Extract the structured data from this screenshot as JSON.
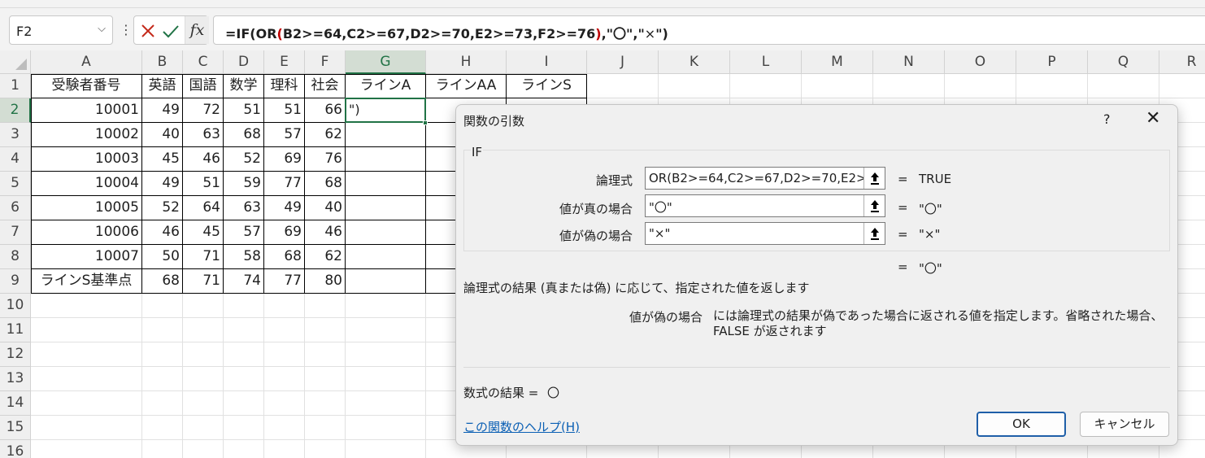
{
  "namebox": {
    "value": "F2"
  },
  "formula_bar": {
    "fx_label": "fx",
    "parts": [
      "=IF",
      "(",
      "OR",
      "(",
      "B2>=64,C2>=67,D2>=70,E2>=73,F2>=76",
      ")",
      ",\"〇\",\"",
      "×",
      "\")"
    ]
  },
  "sheet": {
    "columns": [
      "A",
      "B",
      "C",
      "D",
      "E",
      "F",
      "G",
      "H",
      "I",
      "J",
      "K",
      "L",
      "M",
      "N",
      "O",
      "P",
      "Q",
      "R"
    ],
    "rows": [
      "1",
      "2",
      "3",
      "4",
      "5",
      "6",
      "7",
      "8",
      "9",
      "10",
      "11",
      "12",
      "13",
      "14",
      "15",
      "16"
    ],
    "header_row": [
      "受験者番号",
      "英語",
      "国語",
      "数学",
      "理科",
      "社会",
      "ラインA",
      "ラインAA",
      "ラインS"
    ],
    "data_rows": [
      [
        "10001",
        "49",
        "72",
        "51",
        "51",
        "66"
      ],
      [
        "10002",
        "40",
        "63",
        "68",
        "57",
        "62"
      ],
      [
        "10003",
        "45",
        "46",
        "52",
        "69",
        "76"
      ],
      [
        "10004",
        "49",
        "51",
        "59",
        "77",
        "68"
      ],
      [
        "10005",
        "52",
        "64",
        "63",
        "49",
        "40"
      ],
      [
        "10006",
        "46",
        "45",
        "57",
        "69",
        "46"
      ],
      [
        "10007",
        "50",
        "71",
        "58",
        "68",
        "62"
      ],
      [
        "ラインS基準点",
        "68",
        "71",
        "74",
        "77",
        "80"
      ]
    ],
    "active_cell_text": "\")"
  },
  "dialog": {
    "title": "関数の引数",
    "help_glyph": "?",
    "close_glyph": "✕",
    "function_name": "IF",
    "args": [
      {
        "label": "論理式",
        "value": "OR(B2>=64,C2>=67,D2>=70,E2>",
        "eq": "=",
        "result": "TRUE"
      },
      {
        "label": "値が真の場合",
        "value": "\"〇\"",
        "eq": "=",
        "result": "\"〇\""
      },
      {
        "label": "値が偽の場合",
        "value": "\"×\"",
        "eq": "=",
        "result": "\"×\""
      }
    ],
    "overall_eq": "=",
    "overall_result": "\"〇\"",
    "description": "論理式の結果 (真または偽) に応じて、指定された値を返します",
    "arg_desc_name": "値が偽の場合",
    "arg_desc_text": "には論理式の結果が偽であった場合に返される値を指定します。省略された場合、FALSE が返されます",
    "formula_result_label": "数式の結果 =",
    "formula_result_value": "〇",
    "help_link": "この関数のヘルプ(H)",
    "ok_label": "OK",
    "cancel_label": "キャンセル"
  }
}
